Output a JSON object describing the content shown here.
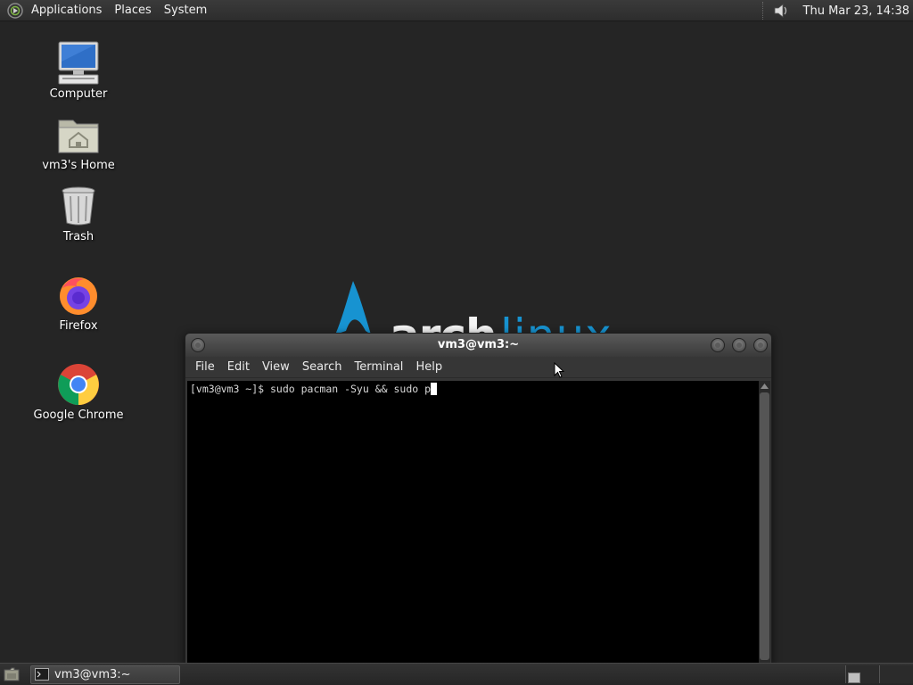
{
  "top_panel": {
    "menus": [
      "Applications",
      "Places",
      "System"
    ],
    "clock": "Thu Mar 23, 14:38"
  },
  "desktop_icons": [
    {
      "label": "Computer",
      "icon": "computer-icon"
    },
    {
      "label": "vm3's Home",
      "icon": "home-folder-icon"
    },
    {
      "label": "Trash",
      "icon": "trash-icon"
    },
    {
      "label": "Firefox",
      "icon": "firefox-icon"
    },
    {
      "label": "Google Chrome",
      "icon": "chrome-icon"
    }
  ],
  "wallpaper": {
    "brand": "arch",
    "brand_suffix": "linux"
  },
  "terminal": {
    "title": "vm3@vm3:~",
    "menu": [
      "File",
      "Edit",
      "View",
      "Search",
      "Terminal",
      "Help"
    ],
    "line": "[vm3@vm3 ~]$ sudo pacman -Syu && sudo p"
  },
  "taskbar": {
    "tasks": [
      {
        "label": "vm3@vm3:~",
        "icon": "terminal-icon"
      }
    ]
  },
  "colors": {
    "desktop_bg": "#252525",
    "arch_blue": "#1793d1",
    "panel": "#2d2d2d",
    "terminal_bg": "#000000"
  }
}
